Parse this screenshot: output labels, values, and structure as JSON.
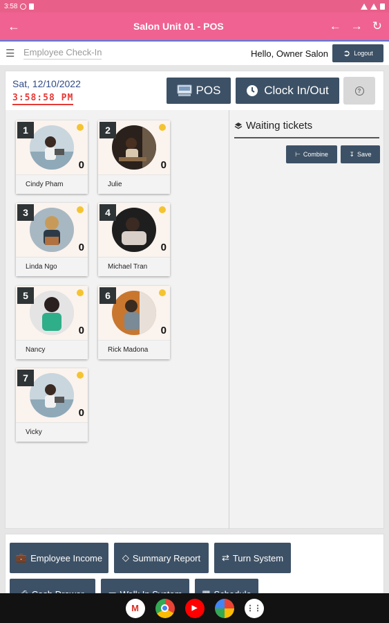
{
  "status_bar": {
    "time": "3:58"
  },
  "app_bar": {
    "title": "Salon Unit 01 - POS"
  },
  "header": {
    "page_name": "Employee Check-In",
    "greeting": "Hello, Owner Salon",
    "logout_label": "Logout"
  },
  "top": {
    "date": "Sat, 12/10/2022",
    "time": "3:58:58 PM",
    "pos_label": "POS",
    "clock_label": "Clock In/Out"
  },
  "employees": [
    {
      "num": "1",
      "name": "Cindy Pham",
      "count": "0"
    },
    {
      "num": "2",
      "name": "Julie",
      "count": "0"
    },
    {
      "num": "3",
      "name": "Linda Ngo",
      "count": "0"
    },
    {
      "num": "4",
      "name": "Michael Tran",
      "count": "0"
    },
    {
      "num": "5",
      "name": "Nancy",
      "count": "0"
    },
    {
      "num": "6",
      "name": "Rick Madona",
      "count": "0"
    },
    {
      "num": "7",
      "name": "Vicky",
      "count": "0"
    }
  ],
  "waiting": {
    "title": "Waiting tickets",
    "combine_label": "Combine",
    "save_label": "Save"
  },
  "tools": {
    "employee_income": "Employee Income",
    "summary_report": "Summary Report",
    "turn_system": "Turn System",
    "cash_drawer": "Cash Drawer",
    "walk_in_system": "Walk In System",
    "schedule": "Schedule"
  },
  "colors": {
    "primary": "#f06292",
    "button": "#3d5166",
    "status_dot": "#f4c430",
    "time_red": "#e53935"
  }
}
